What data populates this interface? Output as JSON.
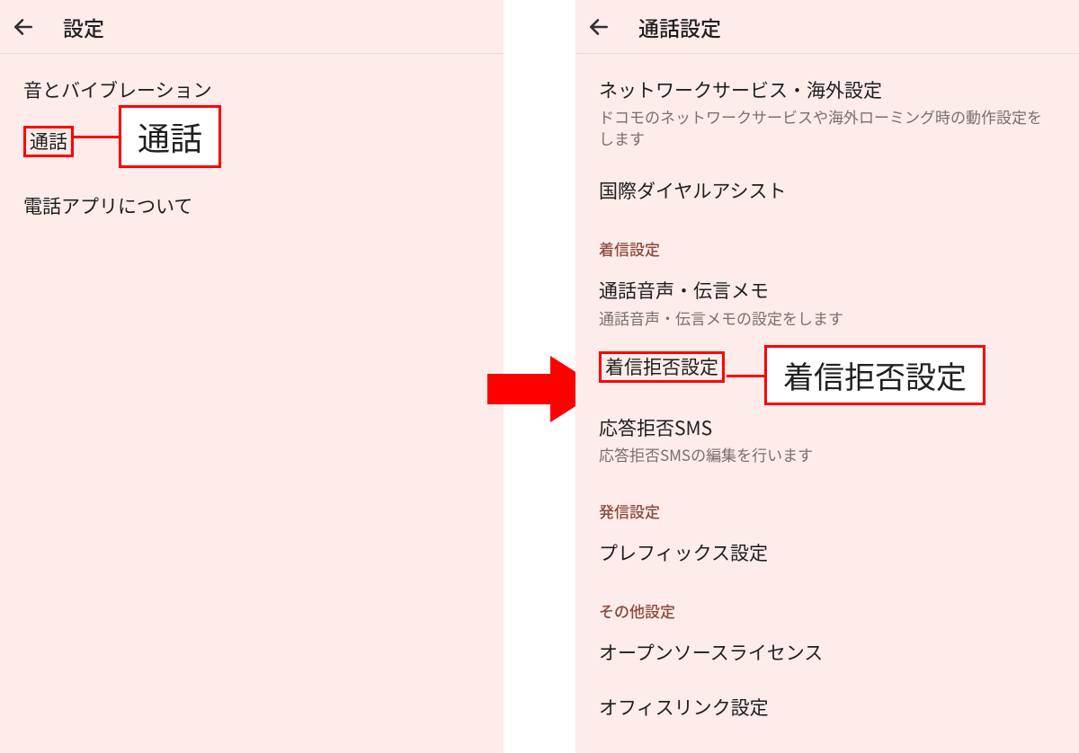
{
  "left": {
    "title": "設定",
    "items": [
      {
        "label": "音とバイブレーション"
      },
      {
        "label": "通話",
        "highlight": true
      },
      {
        "label": "電話アプリについて"
      }
    ],
    "callout": "通話"
  },
  "right": {
    "title": "通話設定",
    "rows": [
      {
        "kind": "item",
        "label": "ネットワークサービス・海外設定",
        "sub": "ドコモのネットワークサービスや海外ローミング時の動作設定をします"
      },
      {
        "kind": "item",
        "label": "国際ダイヤルアシスト"
      },
      {
        "kind": "header",
        "label": "着信設定"
      },
      {
        "kind": "item",
        "label": "通話音声・伝言メモ",
        "sub": "通話音声・伝言メモの設定をします"
      },
      {
        "kind": "item",
        "label": "着信拒否設定",
        "highlight": true
      },
      {
        "kind": "item",
        "label": "応答拒否SMS",
        "sub": "応答拒否SMSの編集を行います"
      },
      {
        "kind": "header",
        "label": "発信設定"
      },
      {
        "kind": "item",
        "label": "プレフィックス設定"
      },
      {
        "kind": "header",
        "label": "その他設定"
      },
      {
        "kind": "item",
        "label": "オープンソースライセンス"
      },
      {
        "kind": "item",
        "label": "オフィスリンク設定"
      }
    ],
    "callout": "着信拒否設定"
  }
}
